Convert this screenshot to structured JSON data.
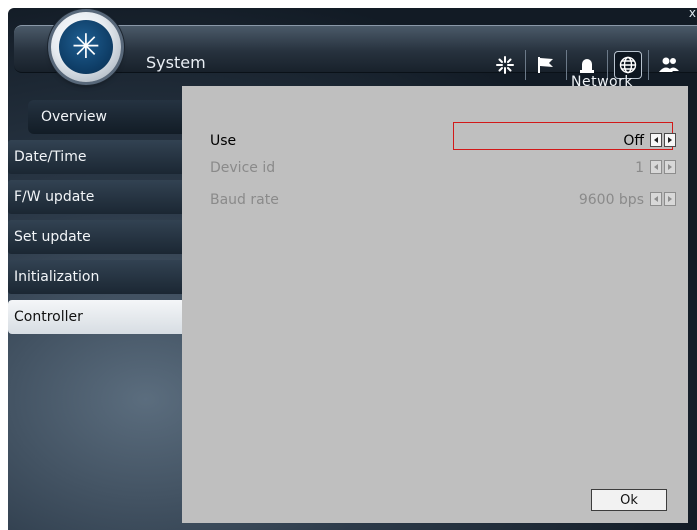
{
  "window": {
    "close_label": "x"
  },
  "header": {
    "title": "System"
  },
  "toolbar": {
    "items": [
      {
        "icon": "spark-icon"
      },
      {
        "icon": "flag-icon"
      },
      {
        "icon": "alarm-icon"
      },
      {
        "icon": "globe-icon",
        "active": true
      },
      {
        "icon": "users-icon"
      }
    ]
  },
  "section_title": "Network",
  "sidebar": {
    "items": [
      {
        "label": "Overview"
      },
      {
        "label": "Date/Time"
      },
      {
        "label": "F/W update"
      },
      {
        "label": "Set update"
      },
      {
        "label": "Initialization"
      },
      {
        "label": "Controller",
        "selected": true
      }
    ]
  },
  "settings": {
    "use": {
      "label": "Use",
      "value": "Off"
    },
    "device_id": {
      "label": "Device id",
      "value": "1"
    },
    "baud_rate": {
      "label": "Baud rate",
      "value": "9600 bps"
    }
  },
  "ok_label": "Ok",
  "colors": {
    "focus_border": "#d21919",
    "panel_bg": "#bfbfbf"
  }
}
